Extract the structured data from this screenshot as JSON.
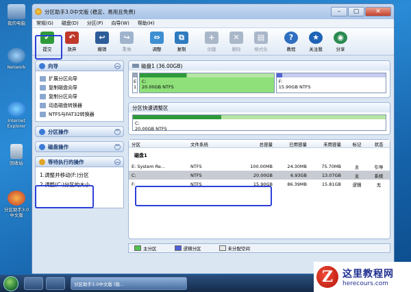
{
  "desktop": {
    "icons": [
      {
        "label": "我的电脑"
      },
      {
        "label": "Network"
      },
      {
        "label": "Internet Explorer"
      },
      {
        "label": "回收站"
      },
      {
        "label": "分区助手3.0中文版"
      }
    ]
  },
  "window": {
    "title": "分区助手3.0中文版 (稳定、易用且免费)",
    "min": "–",
    "max": "▢",
    "close": "✕"
  },
  "menu": [
    "常规(G)",
    "磁盘(D)",
    "分区(P)",
    "向导(W)",
    "帮助(H)"
  ],
  "toolbar": [
    {
      "label": "提交",
      "icon": "✔",
      "color": "#2e9b3a",
      "dim": false
    },
    {
      "label": "放弃",
      "icon": "↶",
      "color": "#c0392b",
      "dim": false
    },
    {
      "label": "撤销",
      "icon": "↩",
      "color": "#2d5c9a",
      "dim": false
    },
    {
      "label": "重做",
      "icon": "↪",
      "color": "#9fb3cc",
      "dim": true
    },
    {
      "label": "调整",
      "icon": "⇔",
      "color": "#3d8fd1",
      "dim": false
    },
    {
      "label": "复制",
      "icon": "⧉",
      "color": "#2e7bbf",
      "dim": false
    },
    {
      "label": "创建",
      "icon": "+",
      "color": "#a9b7c9",
      "dim": true
    },
    {
      "label": "删除",
      "icon": "✕",
      "color": "#a9b7c9",
      "dim": true
    },
    {
      "label": "格式化",
      "icon": "▤",
      "color": "#a9b7c9",
      "dim": true
    },
    {
      "label": "教程",
      "icon": "?",
      "color": "#2f6fc2",
      "dim": false
    },
    {
      "label": "关注我",
      "icon": "★",
      "color": "#1e63b6",
      "dim": false
    },
    {
      "label": "分享",
      "icon": "◉",
      "color": "#2a8b50",
      "dim": false
    }
  ],
  "left": {
    "wizard_title": "向导",
    "wizard_items": [
      "扩展分区向导",
      "复制磁盘向导",
      "复制分区向导",
      "动态磁盘转换器",
      "NTFS与FAT32转换器"
    ],
    "partition_ops": "分区操作",
    "disk_ops": "磁盘操作",
    "pending_title": "等待执行的操作",
    "pending_items": [
      "1.调整并移动(F:)分区",
      "2.调整(C:)分区的大小"
    ]
  },
  "disk_map": {
    "title": "磁盘1 (36.00GB)",
    "parts": [
      {
        "letter": "E",
        "size": "1",
        "fill": 1.0
      },
      {
        "letter": "C:",
        "size": "20.00GB NTFS",
        "fill": 0.35
      },
      {
        "letter": "F:",
        "size": "15.90GB NTFS",
        "fill": 0.05
      }
    ]
  },
  "resize_area": {
    "title": "分区快速调整区",
    "part_letter": "C:",
    "part_size": "20.00GB NTFS",
    "fill": 0.35
  },
  "table": {
    "headers": [
      "分区",
      "文件系统",
      "总容量",
      "已用容量",
      "未用容量",
      "标记",
      "状态"
    ],
    "disk_label": "磁盘1",
    "rows": [
      {
        "name": "E: System Re...",
        "fs": "NTFS",
        "total": "100.00MB",
        "used": "24.30MB",
        "free": "75.70MB",
        "flag": "主",
        "status": "引导",
        "selected": false
      },
      {
        "name": "C:",
        "fs": "NTFS",
        "total": "20.00GB",
        "used": "6.93GB",
        "free": "13.07GB",
        "flag": "主",
        "status": "系统",
        "selected": true
      },
      {
        "name": "F:",
        "fs": "NTFS",
        "total": "15.90GB",
        "used": "86.39MB",
        "free": "15.81GB",
        "flag": "逻辑",
        "status": "无",
        "selected": false
      }
    ]
  },
  "legend": [
    {
      "label": "主分区",
      "color": "#4fc24f"
    },
    {
      "label": "逻辑分区",
      "color": "#4f5fd8"
    },
    {
      "label": "未分配空间",
      "color": "#e8e8e8"
    }
  ],
  "taskbar": {
    "app_label": "分区助手3.0中文版 (稳..."
  },
  "watermark": {
    "logo_letter": "Z",
    "line1": "这里教程网",
    "line2": "herecours.com"
  }
}
